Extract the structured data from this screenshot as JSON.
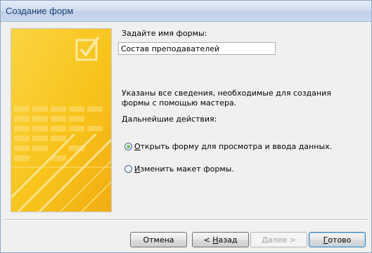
{
  "window": {
    "title": "Создание форм"
  },
  "form_name": {
    "label": "Задайте имя формы:",
    "value": "Состав преподавателей"
  },
  "info_text": "Указаны все сведения, необходимые для создания формы с помощью мастера.",
  "next_actions_label": "Дальнейшие действия:",
  "options": [
    {
      "accel": "О",
      "rest": "ткрыть форму для просмотра и ввода данных.",
      "checked": true
    },
    {
      "accel": "И",
      "rest": "зменить макет формы.",
      "checked": false
    }
  ],
  "buttons": {
    "cancel": "Отмена",
    "back_prefix": "< ",
    "back_accel": "Н",
    "back_rest": "азад",
    "next": "Далее >",
    "finish_accel": "Г",
    "finish_rest": "отово"
  },
  "colors": {
    "art_yellow": "#f7c21a",
    "art_light": "#fde07a",
    "title_text": "#1f3d74"
  }
}
